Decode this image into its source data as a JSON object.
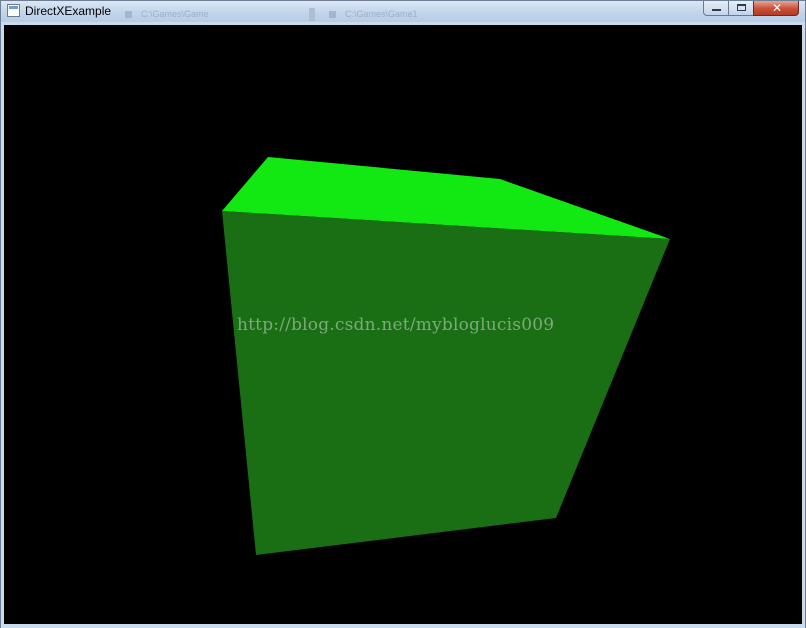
{
  "window": {
    "title": "DirectXExample",
    "app_icon": "window-app-icon",
    "background_tabs": [
      "C:\\Games\\Game",
      "C:\\Games\\Game1"
    ],
    "caption_buttons": {
      "minimize_icon": "minimize-icon",
      "maximize_icon": "maximize-icon",
      "close_icon": "close-icon",
      "close_glyph": "✕"
    }
  },
  "render": {
    "clear_color": "#000000",
    "cube": {
      "top_face_color": "#12e812",
      "front_face_color": "#1a6e14"
    },
    "watermark": "http://blog.csdn.net/mybloglucis009"
  }
}
